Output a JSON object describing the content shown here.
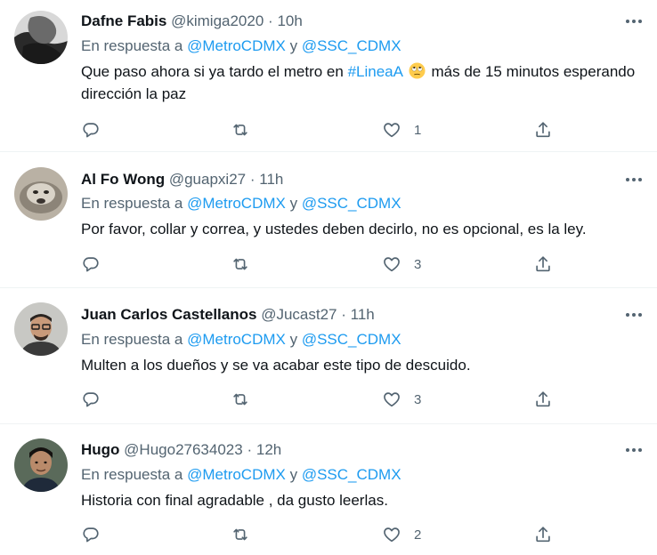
{
  "tweets": [
    {
      "name": "Dafne Fabis",
      "handle": "@kimiga2020",
      "time": "10h",
      "reply_prefix": "En respuesta a",
      "mention1": "@MetroCDMX",
      "reply_joiner": "y",
      "mention2": "@SSC_CDMX",
      "text_before": "Que paso ahora si ya tardo el metro en",
      "hashtag": "#LineaA",
      "emoji": "rolling-eyes-emoji",
      "text_after": "más de 15 minutos esperando dirección la paz",
      "like_count": "1"
    },
    {
      "name": "Al Fo Wong",
      "handle": "@guapxi27",
      "time": "11h",
      "reply_prefix": "En respuesta a",
      "mention1": "@MetroCDMX",
      "reply_joiner": "y",
      "mention2": "@SSC_CDMX",
      "text": "Por favor, collar y correa, y ustedes deben decirlo, no es opcional, es la ley.",
      "like_count": "3"
    },
    {
      "name": "Juan Carlos Castellanos",
      "handle": "@Jucast27",
      "time": "11h",
      "reply_prefix": "En respuesta a",
      "mention1": "@MetroCDMX",
      "reply_joiner": "y",
      "mention2": "@SSC_CDMX",
      "text": "Multen a los dueños y se va acabar este tipo de descuido.",
      "like_count": "3"
    },
    {
      "name": "Hugo",
      "handle": "@Hugo27634023",
      "time": "12h",
      "reply_prefix": "En respuesta a",
      "mention1": "@MetroCDMX",
      "reply_joiner": "y",
      "mention2": "@SSC_CDMX",
      "text": "Historia con final agradable , da gusto leerlas.",
      "like_count": "2"
    }
  ],
  "icons": {
    "reply": "reply-icon",
    "retweet": "retweet-icon",
    "like": "heart-icon",
    "share": "share-icon",
    "more": "more-options-icon"
  },
  "colors": {
    "accent": "#1d9bf0",
    "secondary_text": "#536471",
    "primary_text": "#0f1419",
    "divider": "#eff3f4"
  }
}
